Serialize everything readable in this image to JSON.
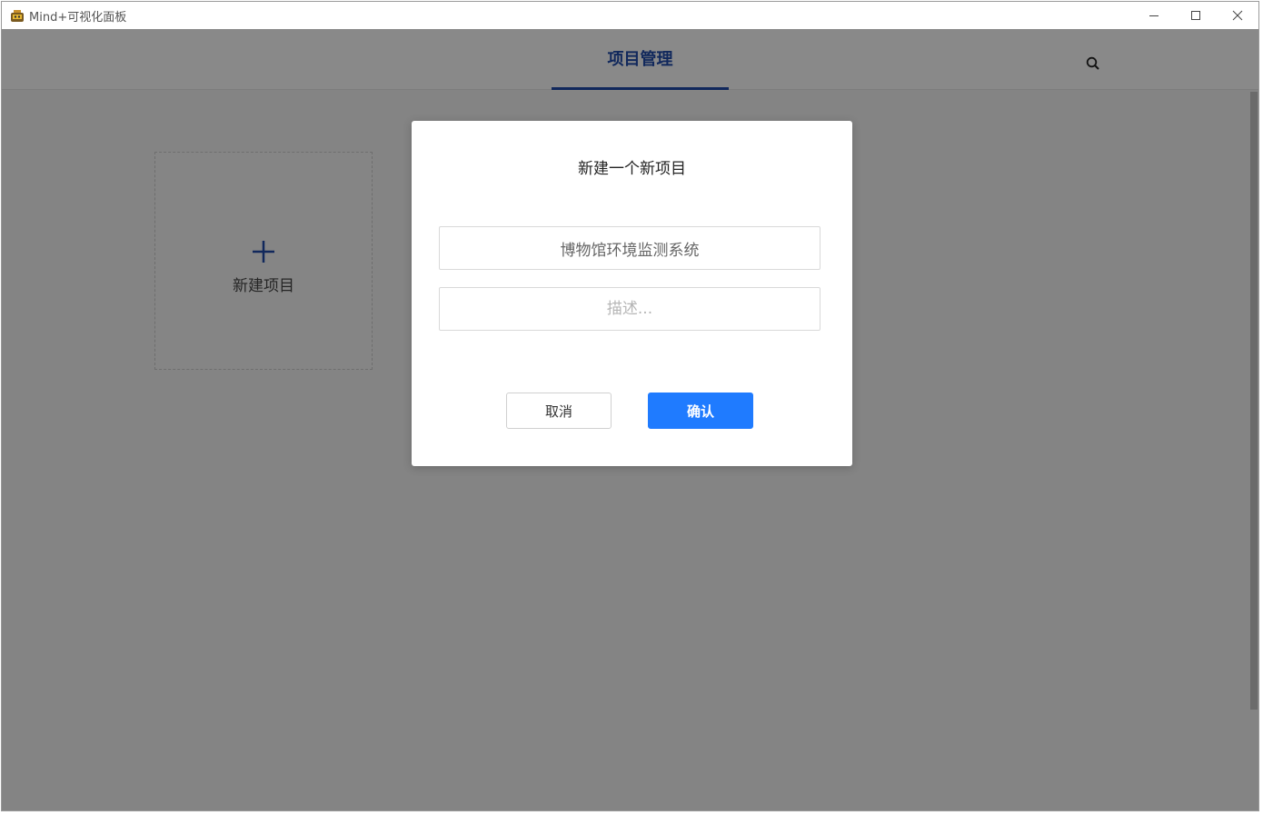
{
  "window": {
    "title": "Mind+可视化面板",
    "icon": "app-logo-icon",
    "controls": [
      "minimize-icon",
      "maximize-icon",
      "close-icon"
    ]
  },
  "header": {
    "tab_label": "项目管理",
    "search_icon": "search-icon"
  },
  "content": {
    "new_project_label": "新建项目",
    "new_project_icon": "plus-icon"
  },
  "dialog": {
    "title": "新建一个新项目",
    "name_value": "博物馆环境监测系统",
    "description_placeholder": "描述...",
    "cancel_label": "取消",
    "confirm_label": "确认"
  },
  "colors": {
    "accent": "#1f4aa8",
    "primary_button": "#1f7bff",
    "overlay": "rgba(0,0,0,0.45)"
  }
}
